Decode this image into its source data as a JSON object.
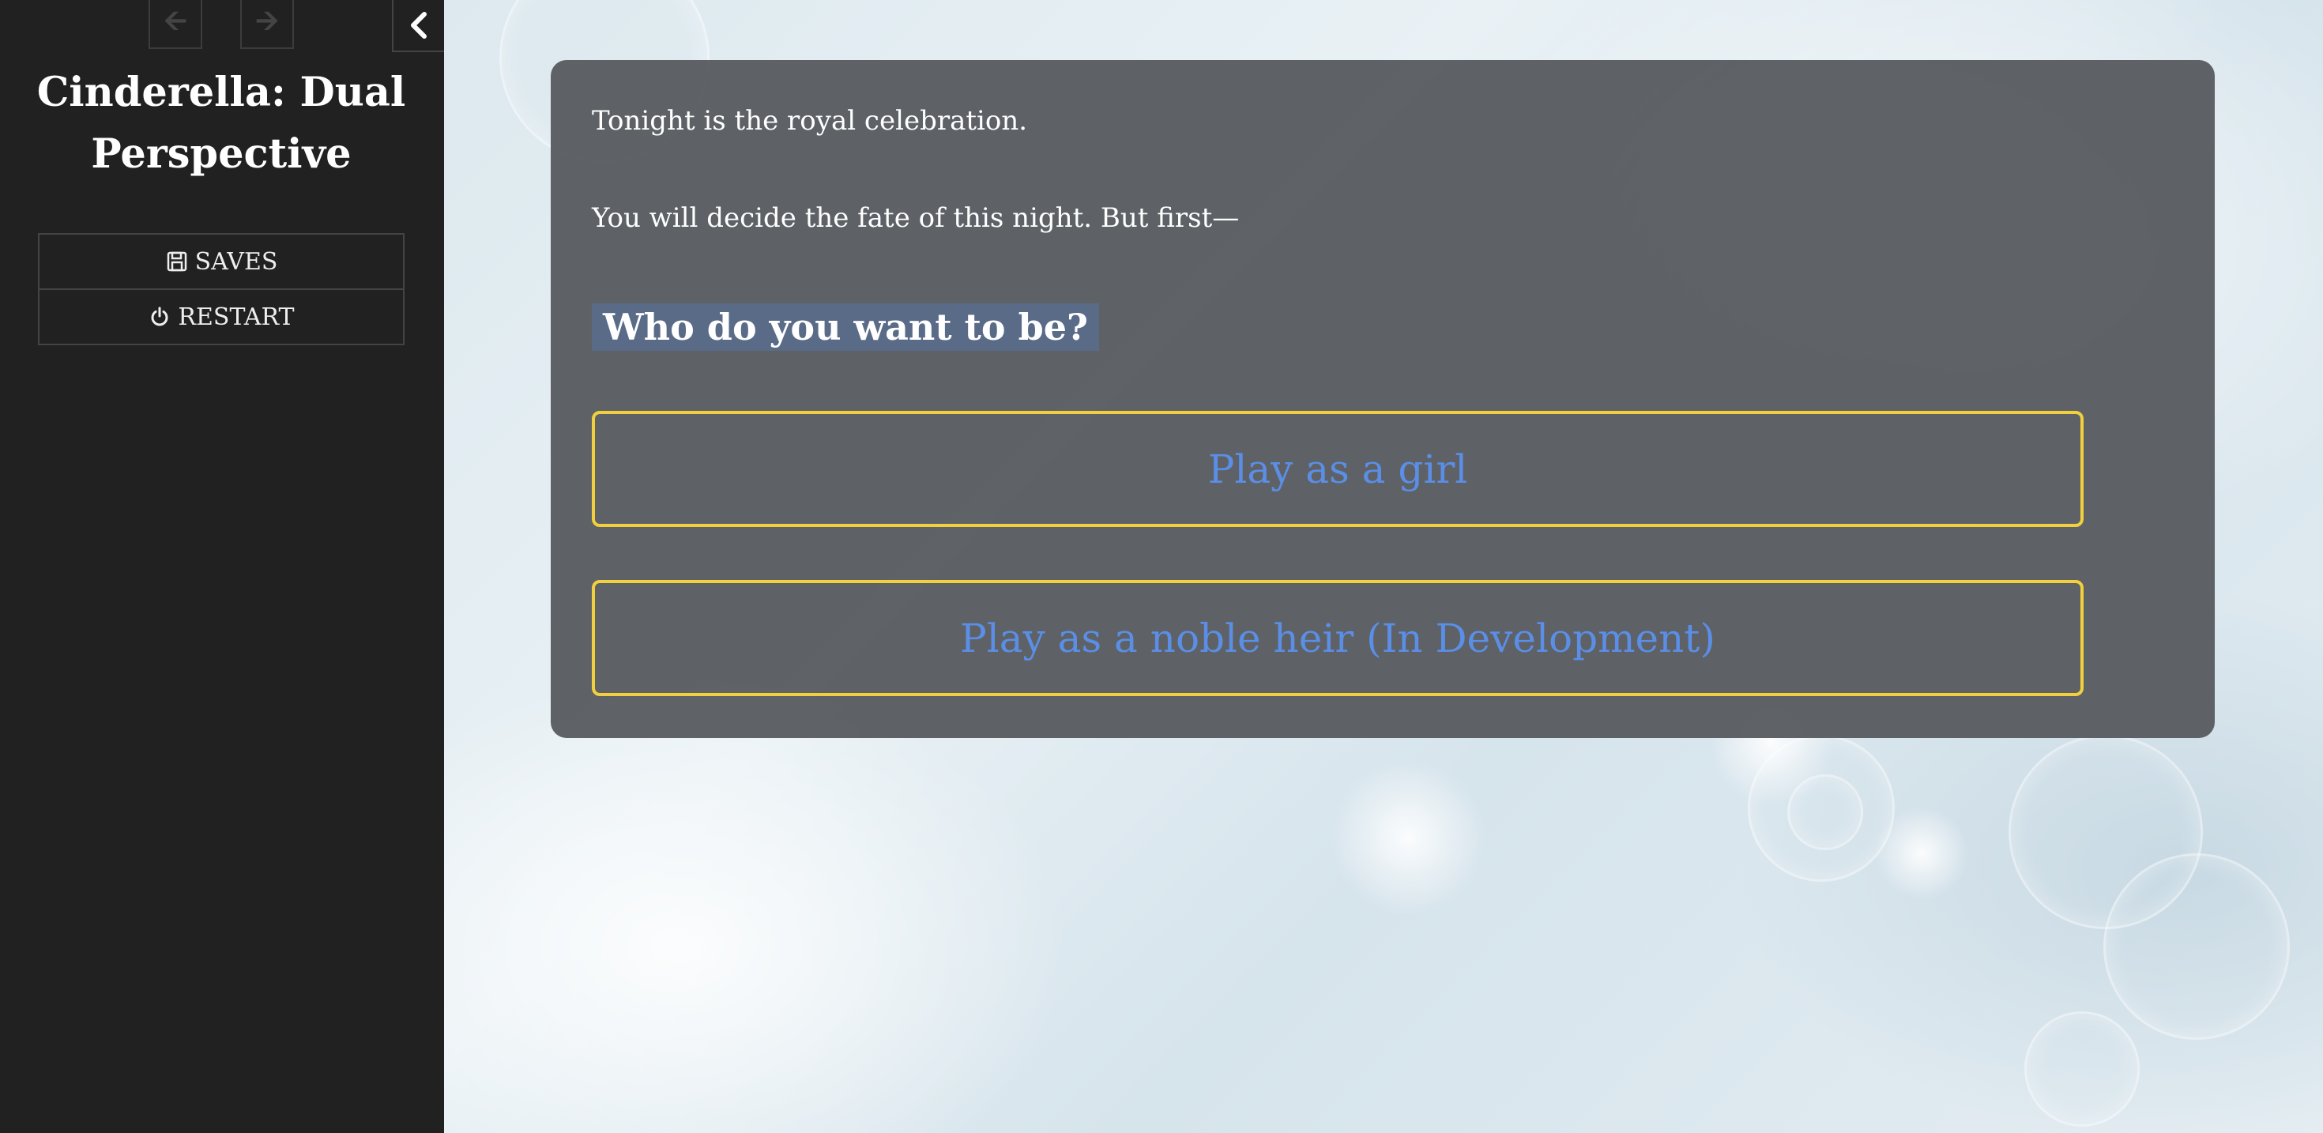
{
  "sidebar": {
    "history_back_icon": "arrow-left-icon",
    "history_forward_icon": "arrow-right-icon",
    "toggle_icon": "chevron-left-icon",
    "title": "Cinderella: Dual Perspective",
    "menu": [
      {
        "label": "SAVES",
        "icon": "floppy-disk-icon"
      },
      {
        "label": "RESTART",
        "icon": "power-icon"
      }
    ]
  },
  "passage": {
    "paragraphs": [
      "Tonight is the royal celebration.",
      "You will decide the fate of this night. But first—"
    ],
    "question": "Who do you want to be?",
    "choices": [
      "Play as a girl",
      "Play as a noble heir (In Development)"
    ]
  },
  "colors": {
    "sidebar_bg": "#212121",
    "panel_bg": "#585c60",
    "choice_border": "#f2cf3d",
    "choice_text": "#5b8ee6",
    "question_highlight": "#5a6b88"
  }
}
